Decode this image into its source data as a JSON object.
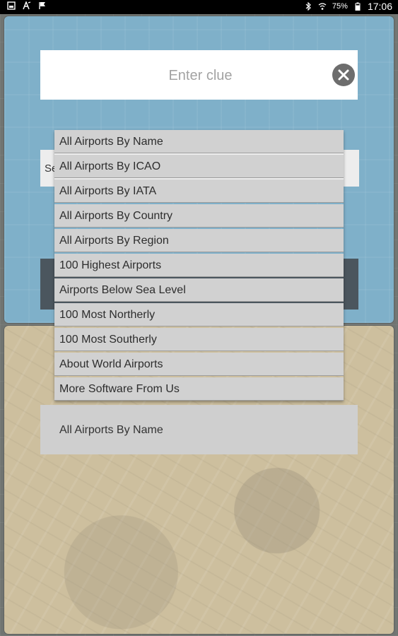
{
  "status_bar": {
    "battery": "75%",
    "time": "17:06",
    "left_icons": [
      "gallery-icon",
      "font-icon",
      "flag-icon"
    ],
    "right_icons": [
      "bluetooth-icon",
      "wifi-icon",
      "battery-icon"
    ]
  },
  "clue": {
    "placeholder": "Enter clue",
    "value": ""
  },
  "search": {
    "visible_text": "Se"
  },
  "dropdown": {
    "items": [
      "All Airports By Name",
      "All Airports By ICAO",
      "All Airports By IATA",
      "All Airports By Country",
      "All Airports By Region",
      "100 Highest Airports",
      "Airports Below Sea Level",
      "100 Most Northerly",
      "100 Most Southerly",
      "About World Airports",
      "More Software From Us"
    ]
  },
  "category": {
    "selected": "All Airports By Name"
  },
  "colors": {
    "top_panel": "#7fb0c9",
    "bottom_panel": "#cdbf9e",
    "dark_button": "#4b565e",
    "dropdown_bg": "#d1d1d1"
  }
}
